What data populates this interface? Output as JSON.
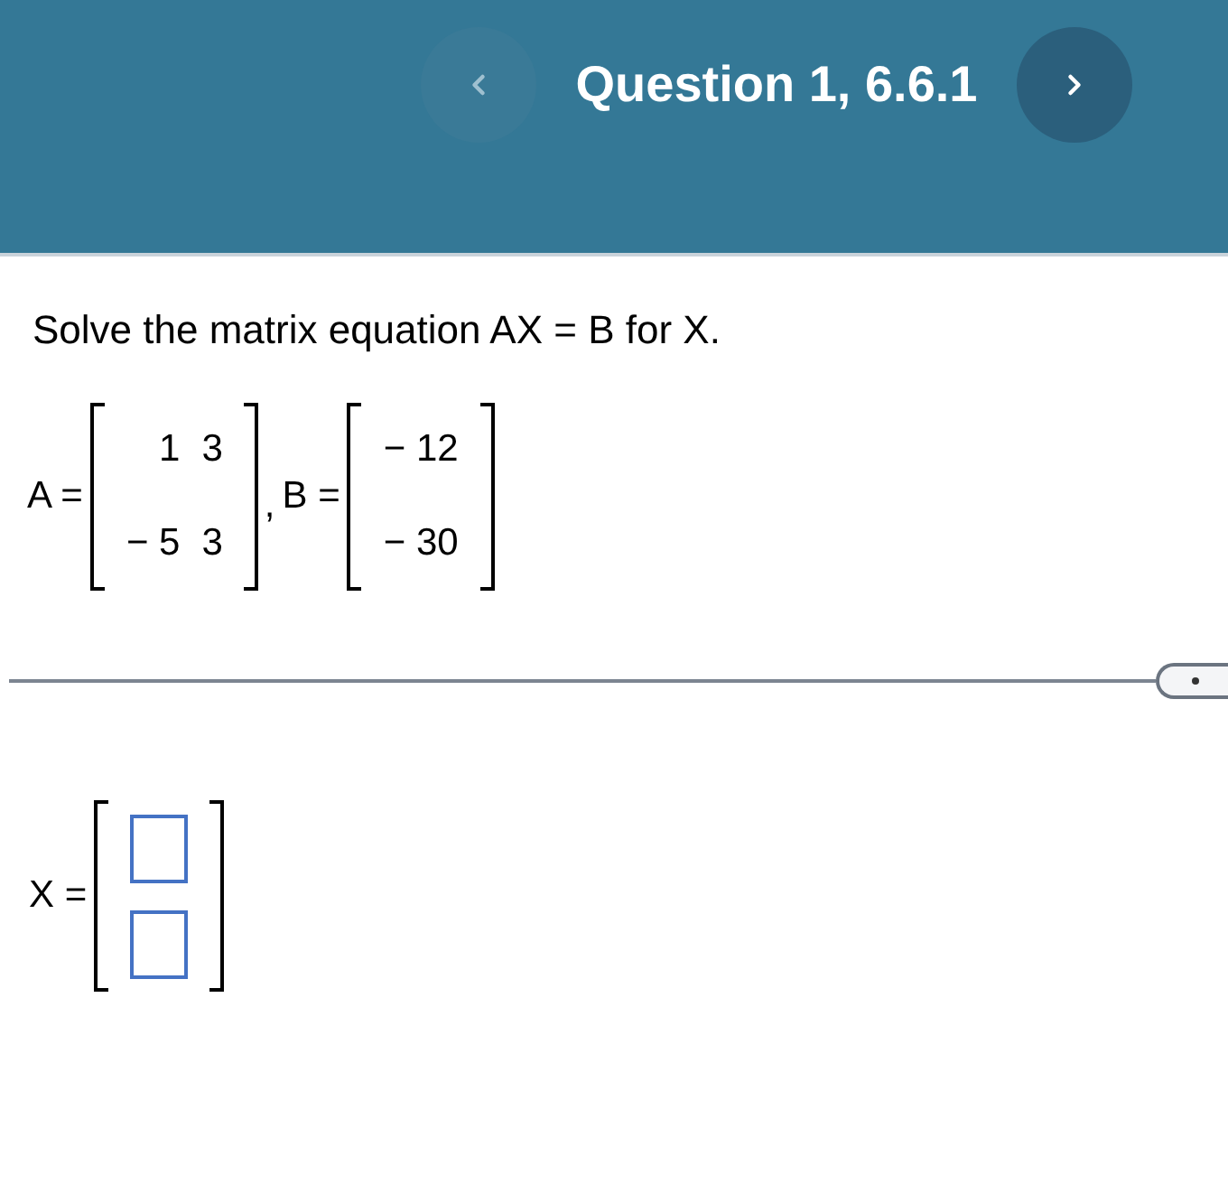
{
  "header": {
    "title": "Question 1, 6.6.1"
  },
  "question": "Solve the matrix equation AX = B for X.",
  "matrices": [
    {
      "label": "A =",
      "rows": [
        [
          "1",
          "3"
        ],
        [
          "− 5",
          "3"
        ]
      ],
      "suffix": ","
    },
    {
      "label": "B =",
      "rows": [
        [
          "− 12"
        ],
        [
          "− 30"
        ]
      ]
    }
  ],
  "answer": {
    "label": "X =",
    "fields": [
      {
        "kind": "input"
      },
      {
        "kind": "input"
      }
    ]
  }
}
